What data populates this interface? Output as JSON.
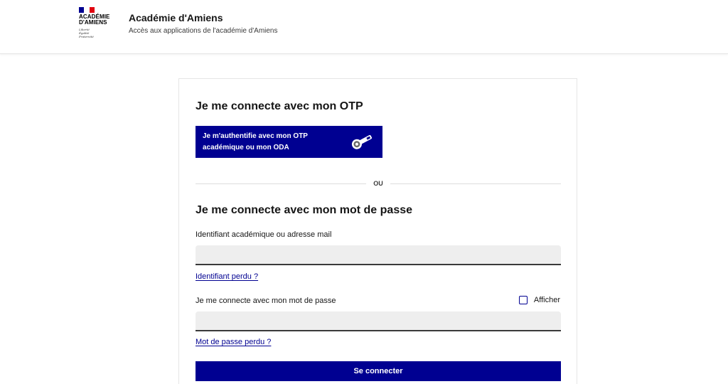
{
  "header": {
    "logo": {
      "name_line1": "ACADÉMIE",
      "name_line2": "D'AMIENS",
      "motto": [
        "Liberté",
        "Égalité",
        "Fraternité"
      ],
      "flag_colors": [
        "#000091",
        "#ffffff",
        "#e1000f"
      ]
    },
    "title": "Académie d'Amiens",
    "tagline": "Accès aux applications de l'académie d'Amiens"
  },
  "otp_section": {
    "title": "Je me connecte avec mon OTP",
    "button_label": "Je m'authentifie avec mon OTP académique ou mon ODA",
    "button_icon": "key-icon"
  },
  "separator": {
    "label": "OU"
  },
  "password_section": {
    "title": "Je me connecte avec mon mot de passe",
    "identifier_label": "Identifiant académique ou adresse mail",
    "identifier_value": "",
    "identifier_lost": "Identifiant perdu ?",
    "password_label": "Je me connecte avec mon mot de passe",
    "password_value": "",
    "show_label": "Afficher",
    "password_lost": "Mot de passe perdu ?",
    "submit_label": "Se connecter"
  },
  "colors": {
    "accent": "#000091",
    "input_bg": "#eeeeee"
  }
}
